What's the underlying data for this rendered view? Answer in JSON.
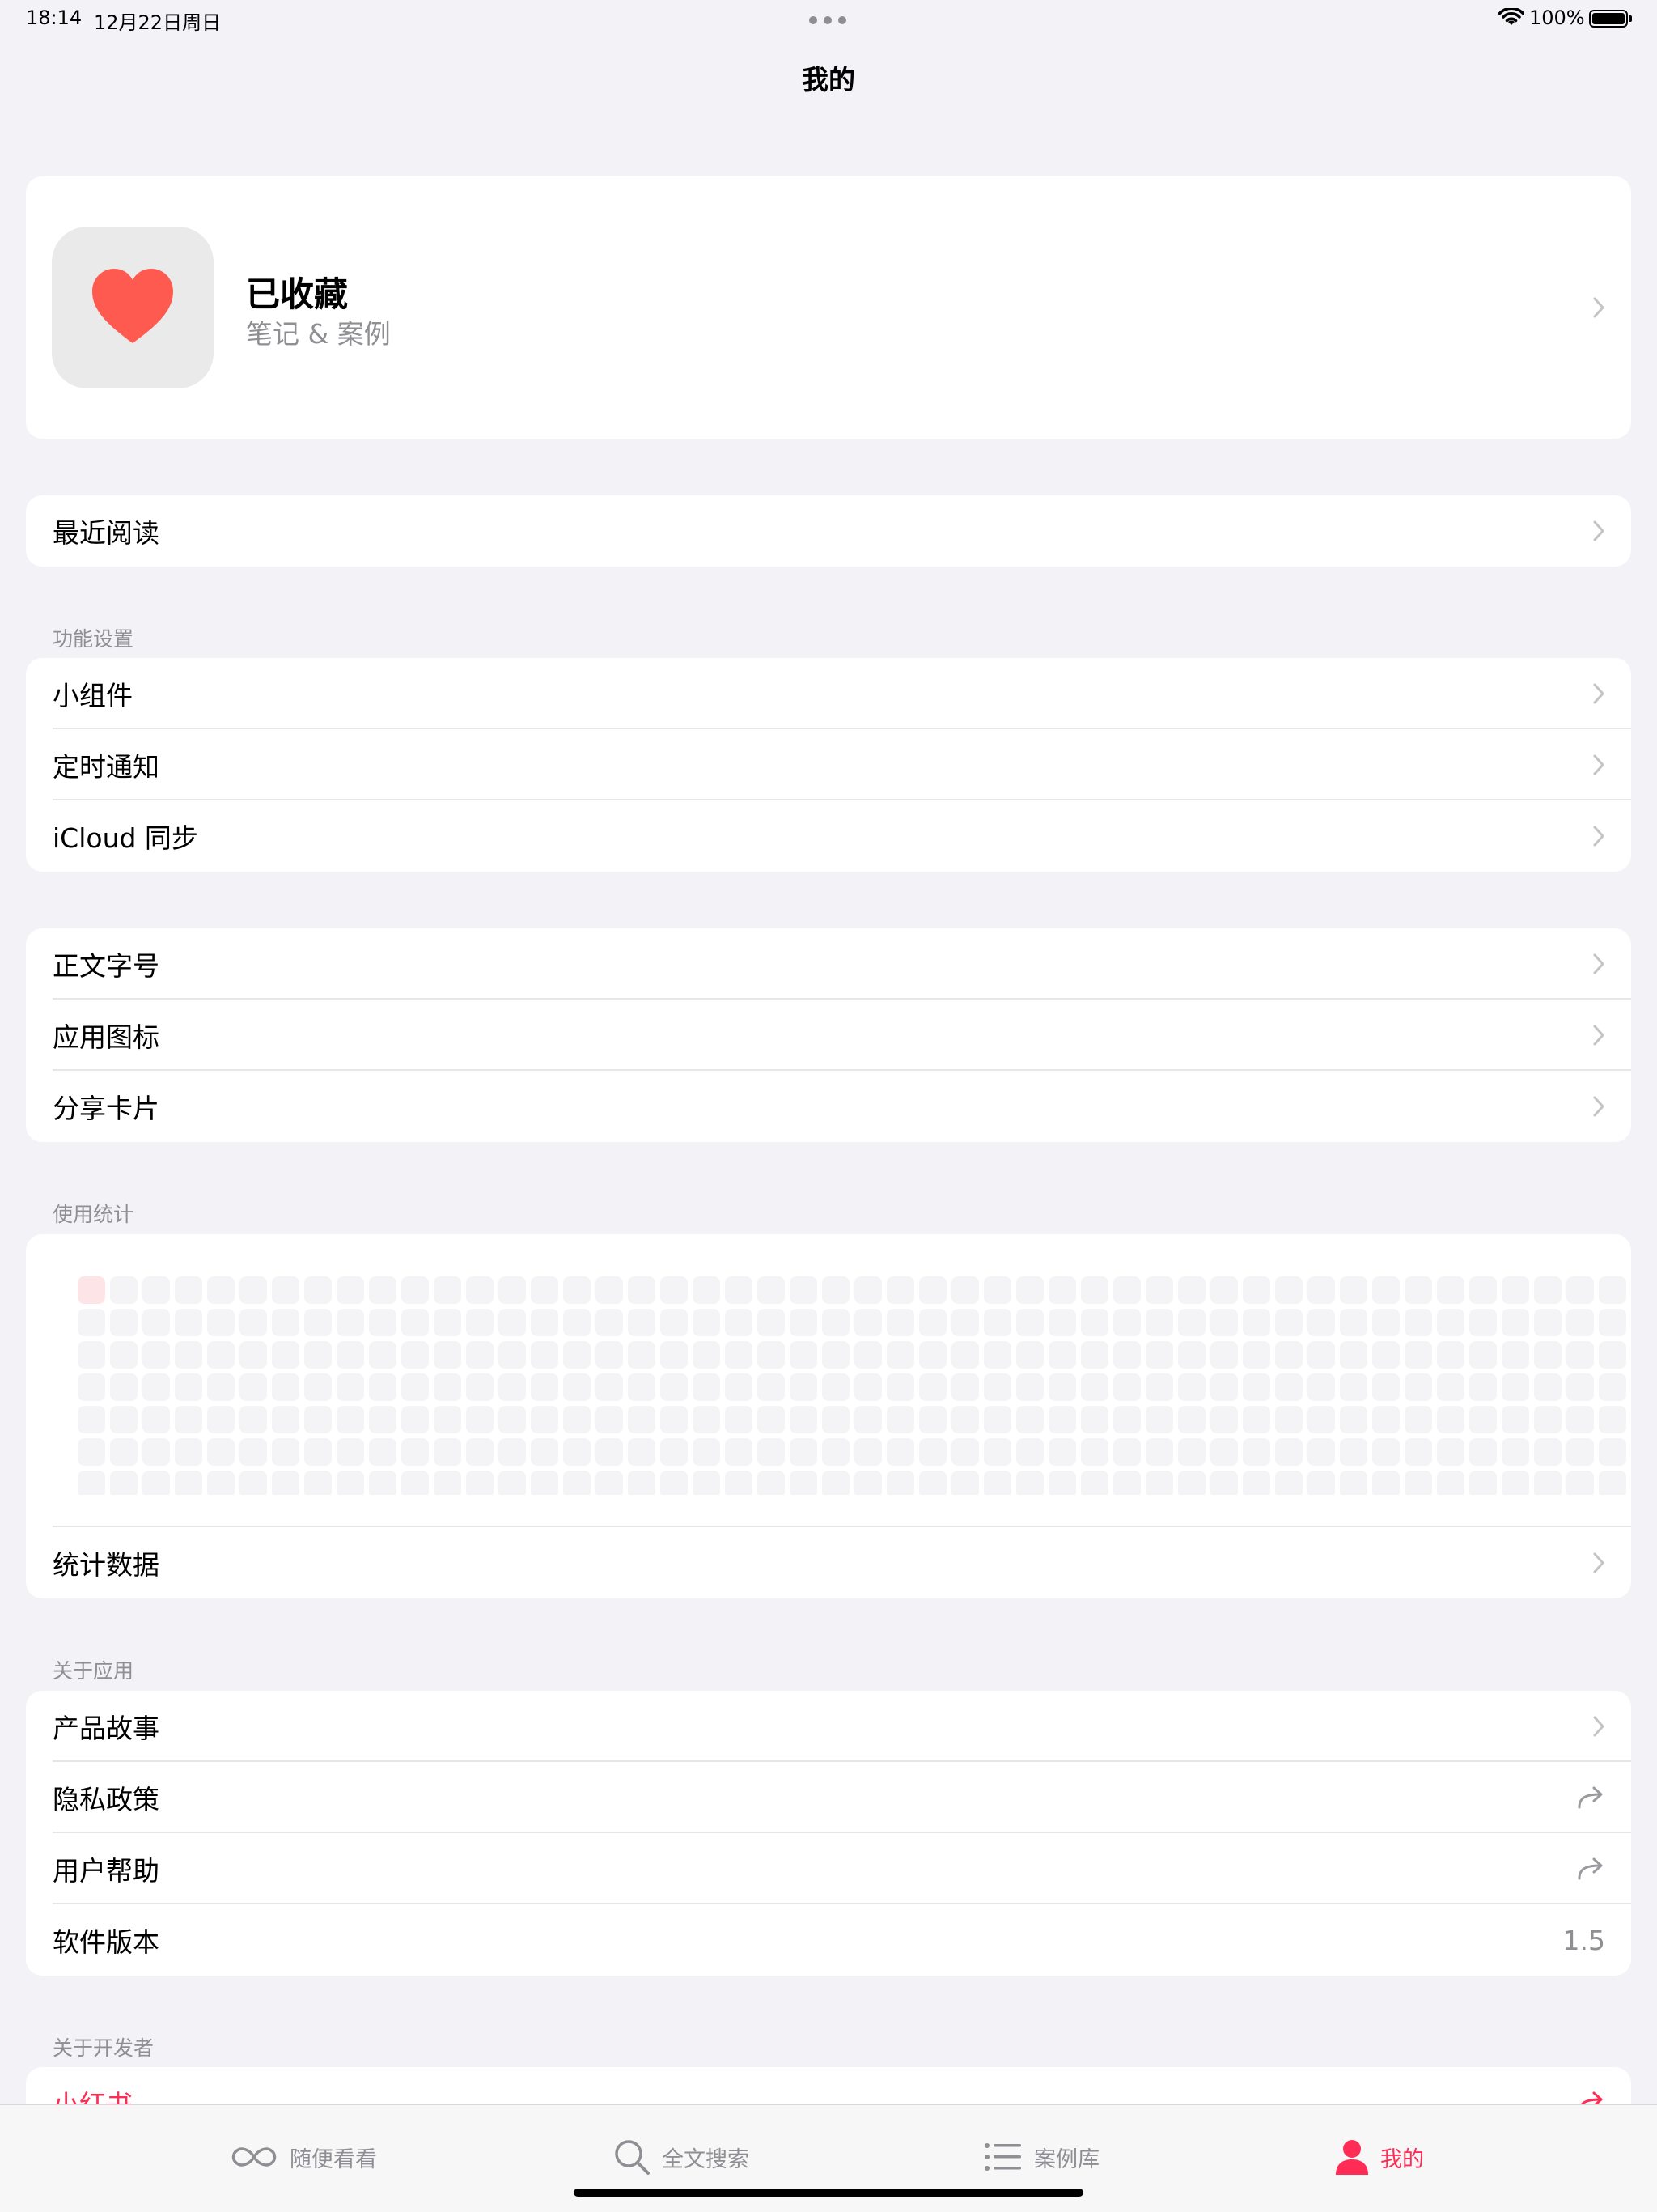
{
  "status_bar": {
    "time": "18:14",
    "date": "12月22日周日",
    "battery": "100%"
  },
  "page_title": "我的",
  "favorites": {
    "title": "已收藏",
    "subtitle": "笔记 & 案例",
    "icon": "heart-icon",
    "icon_color": "#FF5A4F"
  },
  "recent": {
    "label": "最近阅读"
  },
  "settings": {
    "header": "功能设置",
    "items": [
      {
        "label": "小组件"
      },
      {
        "label": "定时通知"
      },
      {
        "label": "iCloud 同步"
      }
    ]
  },
  "display": {
    "items": [
      {
        "label": "正文字号"
      },
      {
        "label": "应用图标"
      },
      {
        "label": "分享卡片"
      }
    ]
  },
  "usage": {
    "header": "使用统计",
    "stats_label": "统计数据",
    "heatmap": {
      "rows": 7,
      "columns": 48,
      "active_cells": [
        [
          0,
          0
        ]
      ],
      "active_color": "#FCE4E7",
      "empty_color": "#F4F4F6"
    }
  },
  "about": {
    "header": "关于应用",
    "items": [
      {
        "label": "产品故事",
        "accessory": "chevron"
      },
      {
        "label": "隐私政策",
        "accessory": "share"
      },
      {
        "label": "用户帮助",
        "accessory": "share"
      },
      {
        "label": "软件版本",
        "value": "1.5"
      }
    ]
  },
  "developer": {
    "header": "关于开发者",
    "items": [
      {
        "label": "小红书",
        "color": "#FF2D55"
      }
    ]
  },
  "tabs": [
    {
      "label": "随便看看",
      "icon": "infinity-icon"
    },
    {
      "label": "全文搜索",
      "icon": "search-icon"
    },
    {
      "label": "案例库",
      "icon": "list-icon"
    },
    {
      "label": "我的",
      "icon": "person-icon",
      "active": true
    }
  ],
  "colors": {
    "accent": "#FF2D55",
    "background": "#F2F2F7"
  }
}
